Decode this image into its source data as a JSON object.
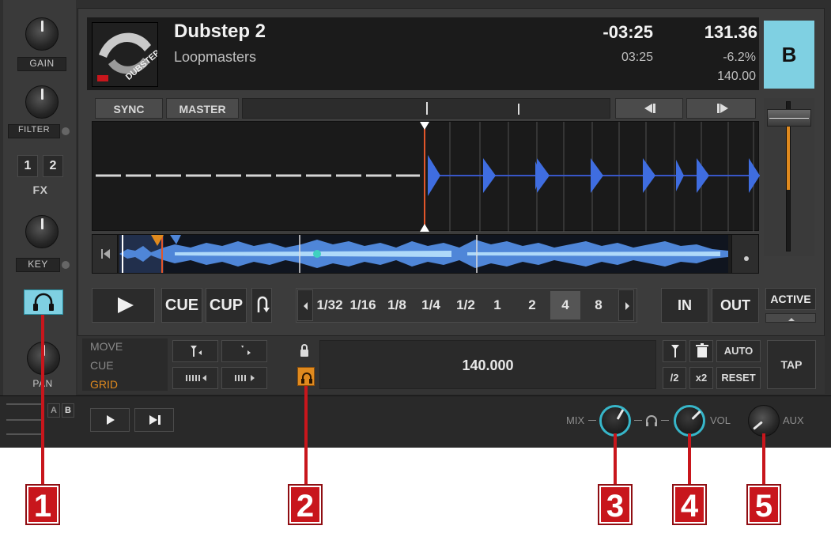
{
  "left_strip": {
    "gain_label": "GAIN",
    "filter_label": "FILTER",
    "fx_buttons": [
      "1",
      "2"
    ],
    "fx_label": "FX",
    "key_label": "KEY",
    "pan_label": "PAN",
    "headphone_icon": "headphone-icon"
  },
  "track": {
    "title": "Dubstep 2",
    "artist": "Loopmasters",
    "remaining_time": "-03:25",
    "elapsed_time": "03:25",
    "bpm": "131.36",
    "pitch": "-6.2%",
    "original_bpm": "140.00",
    "deck_letter": "B",
    "cover_text": "DUBSTEP"
  },
  "sync_row": {
    "sync_label": "SYNC",
    "master_label": "MASTER"
  },
  "transport": {
    "play_icon": "play-icon",
    "cue_label": "CUE",
    "cup_label": "CUP",
    "loop_sizes": [
      "1/32",
      "1/16",
      "1/8",
      "1/4",
      "1/2",
      "1",
      "2",
      "4",
      "8"
    ],
    "selected_loop": "4",
    "in_label": "IN",
    "out_label": "OUT",
    "active_label": "ACTIVE"
  },
  "grid_panel": {
    "modes": [
      "MOVE",
      "CUE",
      "GRID"
    ],
    "active_mode": "GRID",
    "bpm_value": "140.000",
    "auto_label": "AUTO",
    "half_label": "/2",
    "double_label": "x2",
    "reset_label": "RESET",
    "tap_label": "TAP"
  },
  "bottom_bar": {
    "ab_labels": [
      "A",
      "B"
    ],
    "mix_label": "MIX",
    "vol_label": "VOL",
    "aux_label": "AUX"
  },
  "callouts": [
    "1",
    "2",
    "3",
    "4",
    "5"
  ],
  "colors": {
    "accent_teal": "#37b6c9",
    "deck_color": "#7fd0e2",
    "grid_orange": "#e08a1e",
    "callout_red": "#c8161c"
  }
}
